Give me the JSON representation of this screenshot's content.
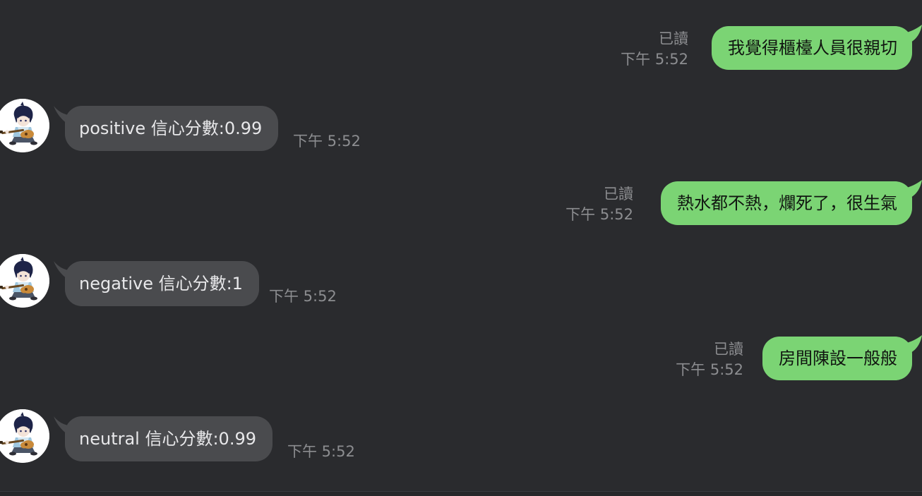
{
  "conversation": {
    "messages": [
      {
        "direction": "outgoing",
        "text": "我覺得櫃檯人員很親切",
        "read_label": "已讀",
        "time": "下午 5:52"
      },
      {
        "direction": "incoming",
        "text": "positive 信心分數:0.99",
        "time": "下午 5:52"
      },
      {
        "direction": "outgoing",
        "text": "熱水都不熱，爛死了，很生氣",
        "read_label": "已讀",
        "time": "下午 5:52"
      },
      {
        "direction": "incoming",
        "text": "negative 信心分數:1",
        "time": "下午 5:52"
      },
      {
        "direction": "outgoing",
        "text": "房間陳設一般般",
        "read_label": "已讀",
        "time": "下午 5:52"
      },
      {
        "direction": "incoming",
        "text": "neutral 信心分數:0.99",
        "time": "下午 5:52"
      }
    ]
  },
  "colors": {
    "background": "#2a2b2e",
    "outgoing_bubble": "#7bd474",
    "incoming_bubble": "#4a4b4e",
    "meta_text": "#8c8d90"
  },
  "icons": {
    "bot_avatar": "guitarist-character-avatar"
  }
}
